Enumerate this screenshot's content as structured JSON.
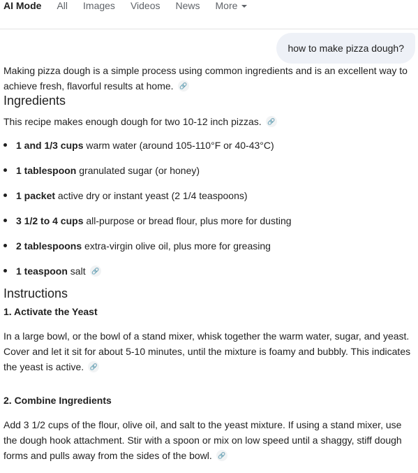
{
  "tabs": [
    {
      "label": "AI Mode",
      "active": true
    },
    {
      "label": "All"
    },
    {
      "label": "Images"
    },
    {
      "label": "Videos"
    },
    {
      "label": "News"
    },
    {
      "label": "More"
    }
  ],
  "query": "how to make pizza dough?",
  "intro": "Making pizza dough is a simple process using common ingredients and is an excellent way to achieve fresh, flavorful results at home.",
  "ingredients": {
    "heading": "Ingredients",
    "note": "This recipe makes enough dough for two 10-12 inch pizzas.",
    "items": [
      {
        "bold": "1 and 1/3 cups",
        "text": " warm water (around 105-110°F or 40-43°C)"
      },
      {
        "bold": "1 tablespoon",
        "text": " granulated sugar (or honey)"
      },
      {
        "bold": "1 packet",
        "text": " active dry or instant yeast (2 1/4 teaspoons)"
      },
      {
        "bold": "3 1/2 to 4 cups",
        "text": " all-purpose or bread flour, plus more for dusting"
      },
      {
        "bold": "2 tablespoons",
        "text": " extra-virgin olive oil, plus more for greasing"
      },
      {
        "bold": "1 teaspoon",
        "text": " salt"
      }
    ]
  },
  "instructions": {
    "heading": "Instructions",
    "steps": [
      {
        "title": "1. Activate the Yeast",
        "body": "In a large bowl, or the bowl of a stand mixer, whisk together the warm water, sugar, and yeast. Cover and let it sit for about 5-10 minutes, until the mixture is foamy and bubbly. This indicates the yeast is active."
      },
      {
        "title": "2. Combine Ingredients",
        "body": "Add 3 1/2 cups of the flour, olive oil, and salt to the yeast mixture. If using a stand mixer, use the dough hook attachment. Stir with a spoon or mix on low speed until a shaggy, stiff dough forms and pulls away from the sides of the bowl."
      }
    ]
  },
  "icons": {
    "citation": "link-icon",
    "more": "chevron-down-icon"
  },
  "colors": {
    "query_bubble": "#eef1f7",
    "tab_inactive": "#5f6368",
    "text": "#1f1f1f"
  }
}
